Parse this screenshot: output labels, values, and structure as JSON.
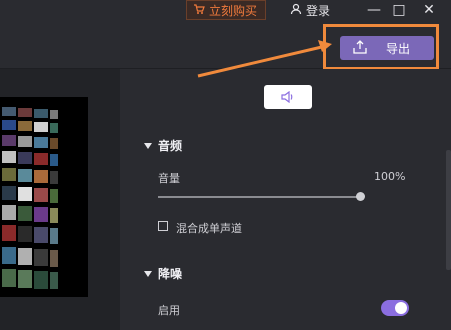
{
  "header": {
    "buy_label": "立刻购买",
    "login_label": "登录",
    "controls": {
      "minimize": "—",
      "maximize": "□",
      "close": "✕"
    }
  },
  "toolbar": {
    "export_label": "导出"
  },
  "audio": {
    "section_title": "音频",
    "volume_label": "音量",
    "volume_value": "100%",
    "volume_level": 1.0,
    "mono_label": "混合成单声道"
  },
  "denoise": {
    "section_title": "降噪",
    "enable_label": "启用",
    "enabled": true
  },
  "colors": {
    "accent": "#7b68b8",
    "toggle_on": "#8b6ee0",
    "highlight": "#f08a3c"
  }
}
